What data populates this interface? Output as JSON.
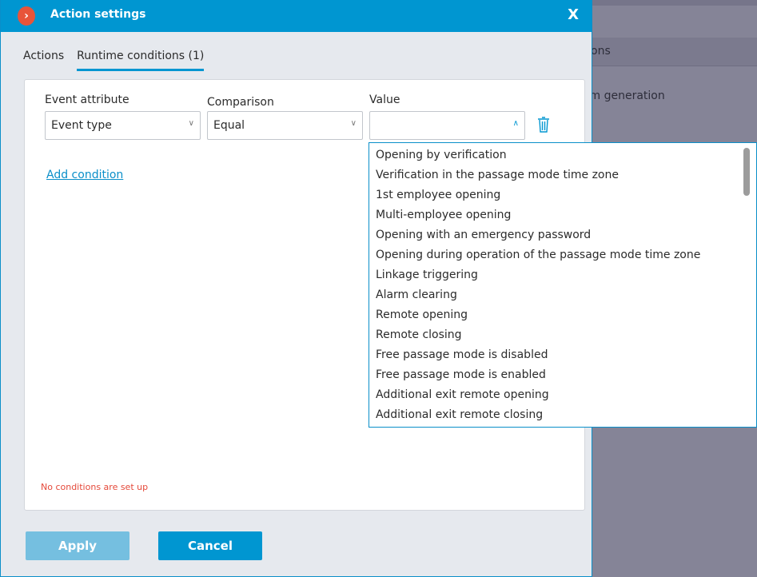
{
  "background": {
    "header_text": "ons",
    "row_text": "rm generation"
  },
  "dialog": {
    "title": "Action settings",
    "close_label": "X",
    "logo_glyph": "›"
  },
  "tabs": [
    {
      "label": "Actions"
    },
    {
      "label": "Runtime conditions (1)",
      "active": true
    }
  ],
  "condition": {
    "attribute_label": "Event attribute",
    "attribute_value": "Event type",
    "comparison_label": "Comparison",
    "comparison_value": "Equal",
    "value_label": "Value",
    "value_value": ""
  },
  "add_condition": "Add condition",
  "error": "No conditions are set up",
  "buttons": {
    "apply": "Apply",
    "cancel": "Cancel"
  },
  "options": [
    "Opening by verification",
    "Verification in the passage mode time zone",
    "1st employee opening",
    "Multi-employee opening",
    "Opening with an emergency password",
    "Opening during operation of the passage mode time zone",
    "Linkage triggering",
    "Alarm clearing",
    "Remote opening",
    "Remote closing",
    "Free passage mode is disabled",
    "Free passage mode is enabled",
    "Additional exit remote opening",
    "Additional exit remote closing"
  ],
  "colors": {
    "accent": "#0096d1",
    "error": "#e5493a",
    "logo": "#e8543a"
  }
}
